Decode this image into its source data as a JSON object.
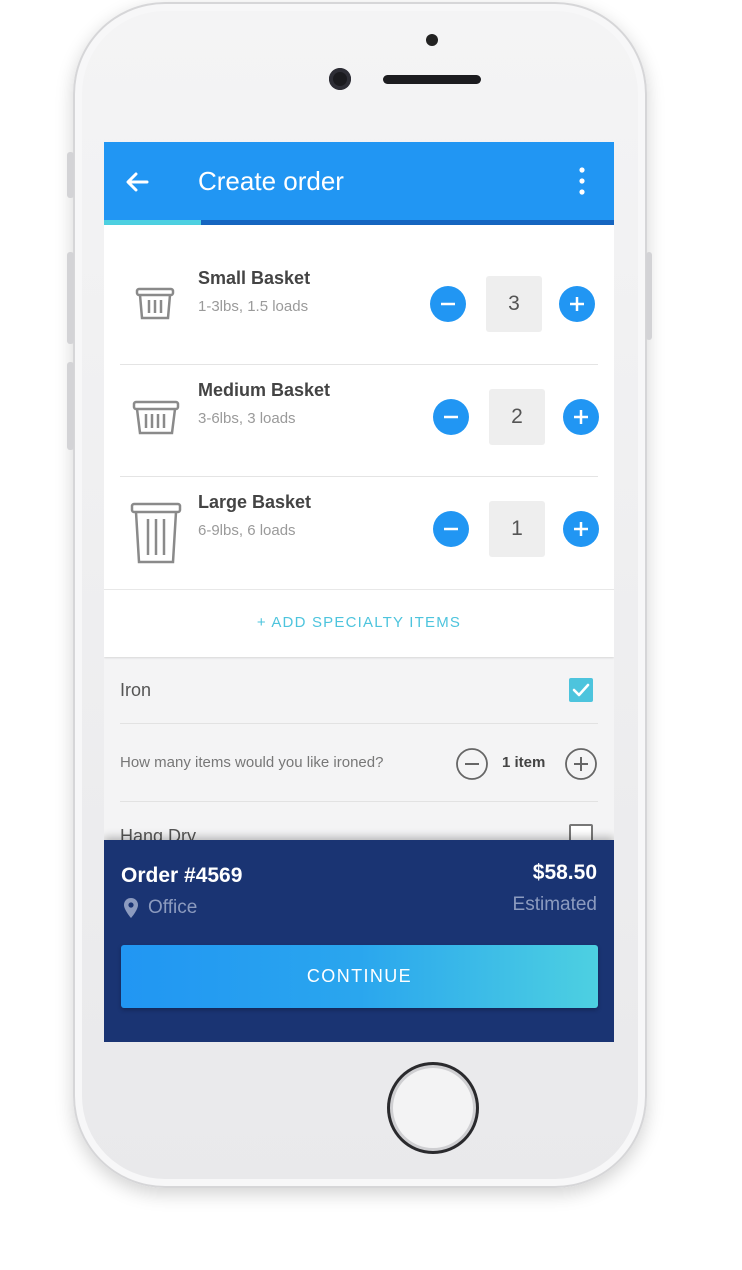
{
  "appbar": {
    "title": "Create order",
    "back_icon": "arrow-left-icon",
    "menu_icon": "more-vertical-icon",
    "progress_fraction": 0.19,
    "color": "#2196f3"
  },
  "baskets": [
    {
      "name": "Small Basket",
      "detail": "1-3lbs, 1.5 loads",
      "quantity": "3",
      "icon": "small-basket-icon"
    },
    {
      "name": "Medium Basket",
      "detail": "3-6lbs, 3 loads",
      "quantity": "2",
      "icon": "medium-basket-icon"
    },
    {
      "name": "Large Basket",
      "detail": "6-9lbs, 6 loads",
      "quantity": "1",
      "icon": "large-basket-icon"
    }
  ],
  "add_specialty_label": "+ ADD SPECIALTY ITEMS",
  "options": {
    "iron": {
      "label": "Iron",
      "checked": true
    },
    "iron_question": "How many items would you like ironed?",
    "iron_count": "1 item",
    "hang_dry": {
      "label": "Hang Dry",
      "checked": false
    }
  },
  "footer": {
    "order_number": "Order #4569",
    "location": "Office",
    "price": "$58.50",
    "price_note": "Estimated",
    "continue_label": "CONTINUE",
    "background": "#1a3473"
  }
}
